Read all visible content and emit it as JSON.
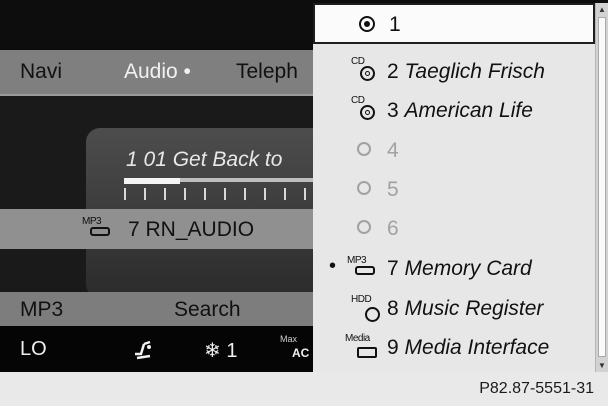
{
  "menu": {
    "items": [
      "Navi",
      "Audio",
      "Telephone"
    ],
    "selected": "Audio",
    "visible_labels": [
      "Navi",
      "Audio •",
      "Teleph"
    ]
  },
  "now_playing": {
    "track": "1 01 Get Back to",
    "progress": 0.28
  },
  "source": {
    "icon": "mp3-icon",
    "label": "7 RN_AUDIO"
  },
  "softkeys": {
    "mp3": "MP3",
    "search": "Search"
  },
  "climate": {
    "temp": "LO",
    "fan": "❄ 1",
    "max_label": "Max",
    "max_ac": "AC"
  },
  "list": [
    {
      "num": "1",
      "label": "",
      "icon": "disc-selected-icon",
      "state": "current"
    },
    {
      "num": "2",
      "label": "Taeglich Frisch",
      "icon": "cd-icon",
      "state": "enabled"
    },
    {
      "num": "3",
      "label": "American Life",
      "icon": "cd-icon",
      "state": "enabled"
    },
    {
      "num": "4",
      "label": "",
      "icon": "radio-empty-icon",
      "state": "disabled"
    },
    {
      "num": "5",
      "label": "",
      "icon": "radio-empty-icon",
      "state": "disabled"
    },
    {
      "num": "6",
      "label": "",
      "icon": "radio-empty-icon",
      "state": "disabled"
    },
    {
      "num": "7",
      "label": "Memory Card",
      "icon": "mp3-icon",
      "state": "active"
    },
    {
      "num": "8",
      "label": "Music Register",
      "icon": "hdd-icon",
      "state": "enabled"
    },
    {
      "num": "9",
      "label": "Media Interface",
      "icon": "media-icon",
      "state": "enabled"
    }
  ],
  "caption": "P82.87-5551-31",
  "colors": {
    "screen": "#161616",
    "list_bg": "#e7e7e7",
    "disabled": "#a2a2a2"
  }
}
